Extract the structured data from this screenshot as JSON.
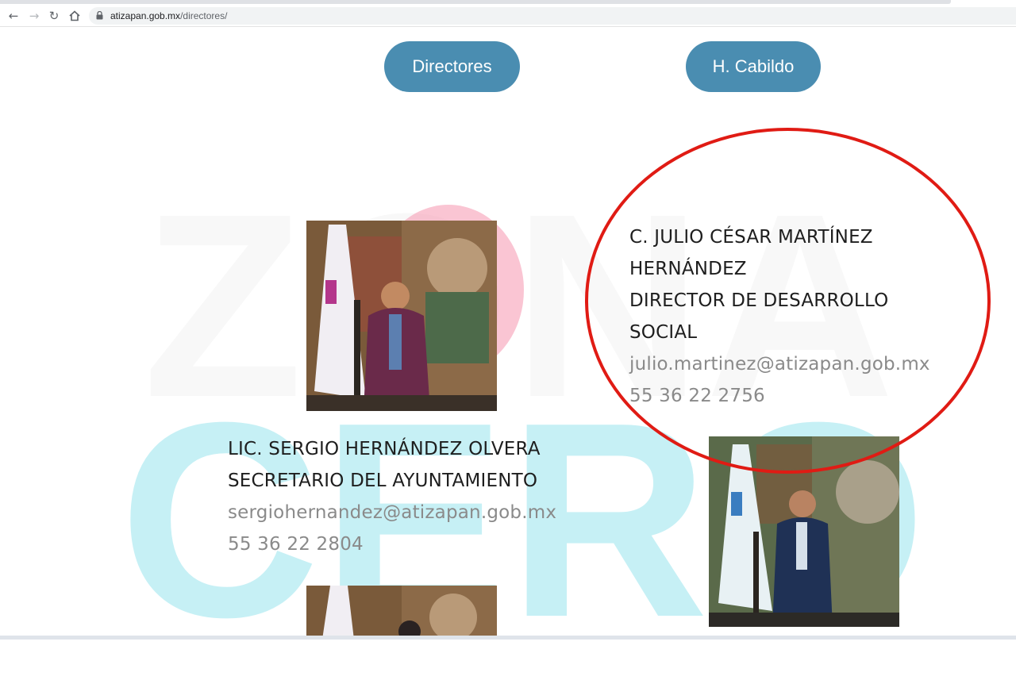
{
  "browser": {
    "back_icon": "arrow-left-icon",
    "forward_icon": "arrow-right-icon",
    "reload_icon": "reload-icon",
    "home_icon": "home-icon",
    "lock_icon": "lock-icon",
    "url_host": "atizapan.gob.mx",
    "url_path": "/directores/"
  },
  "watermark": {
    "line1": "ZONA",
    "line2": "CERO"
  },
  "tabs": [
    {
      "label": "Directores"
    },
    {
      "label": "H. Cabildo"
    }
  ],
  "directors": [
    {
      "name_line1": "C. JULIO CÉSAR MARTÍNEZ",
      "name_line2": "HERNÁNDEZ",
      "title_line1": "DIRECTOR DE DESARROLLO",
      "title_line2": "SOCIAL",
      "email": "julio.martinez@atizapan.gob.mx",
      "phone": "55 36 22 2756"
    },
    {
      "name": "LIC. SERGIO HERNÁNDEZ OLVERA",
      "title": "SECRETARIO DEL AYUNTAMIENTO",
      "email": "sergiohernandez@atizapan.gob.mx",
      "phone": "55 36 22 2804"
    }
  ],
  "colors": {
    "pill": "#4a8db1",
    "annotation": "#e01b14",
    "watermark_cyan": "#c6f0f5",
    "watermark_pink": "#f696af"
  }
}
